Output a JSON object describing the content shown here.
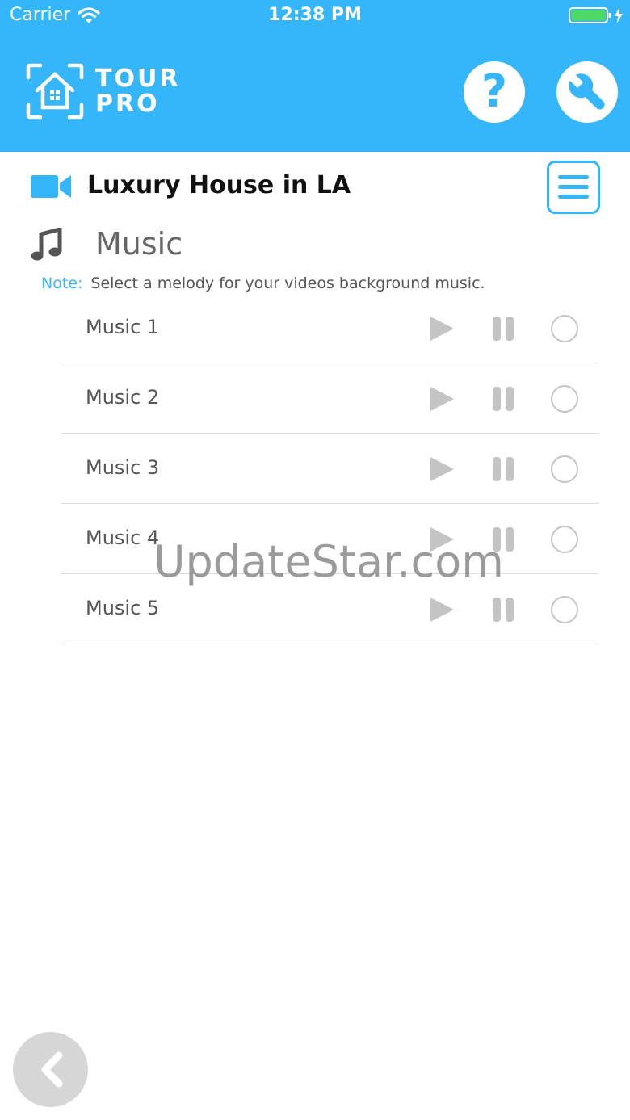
{
  "status_bar": {
    "carrier": "Carrier",
    "time": "12:38 PM",
    "wifi_icon": "wifi-icon",
    "battery_icon": "battery-charging-icon"
  },
  "header": {
    "logo_icon": "house-frame-icon",
    "logo_line1": "TOUR",
    "logo_line2": "PRO",
    "help_label": "?",
    "help_icon": "help-icon",
    "settings_icon": "wrench-icon",
    "background_color": "#35b6fb"
  },
  "project": {
    "icon": "video-camera-icon",
    "title": "Luxury House in LA",
    "menu_icon": "hamburger-menu-icon"
  },
  "section": {
    "icon": "music-note-icon",
    "title": "Music",
    "note_label": "Note:",
    "note_text": "Select a melody for your videos background music."
  },
  "music_list": {
    "items": [
      {
        "label": "Music 1",
        "selected": false
      },
      {
        "label": "Music 2",
        "selected": false
      },
      {
        "label": "Music 3",
        "selected": false
      },
      {
        "label": "Music 4",
        "selected": false
      },
      {
        "label": "Music 5",
        "selected": false
      }
    ],
    "row_icons": [
      "play-icon",
      "pause-icon",
      "radio-icon"
    ]
  },
  "watermark": "UpdateStar.com",
  "footer": {
    "back_icon": "chevron-left-icon"
  },
  "colors": {
    "accent": "#35b6fb",
    "control_gray": "#c4c4c4",
    "text_gray": "#555555",
    "battery_green": "#4cd964"
  }
}
